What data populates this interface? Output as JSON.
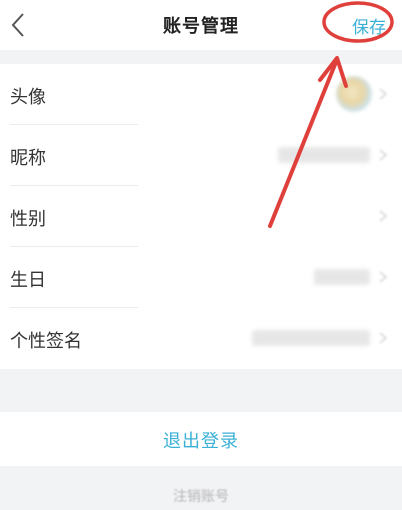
{
  "header": {
    "title": "账号管理",
    "save_label": "保存"
  },
  "profile": {
    "rows": [
      {
        "label": "头像"
      },
      {
        "label": "昵称"
      },
      {
        "label": "性别"
      },
      {
        "label": "生日"
      },
      {
        "label": "个性签名"
      }
    ]
  },
  "actions": {
    "logout_label": "退出登录",
    "delete_account_label": "注销账号"
  },
  "annotation": {
    "marker_color": "#e0403c"
  },
  "colors": {
    "accent": "#3bb0d6",
    "background": "#f2f3f5"
  },
  "icons": {
    "back": "chevron-left-icon",
    "row_arrow": "chevron-right-icon"
  }
}
